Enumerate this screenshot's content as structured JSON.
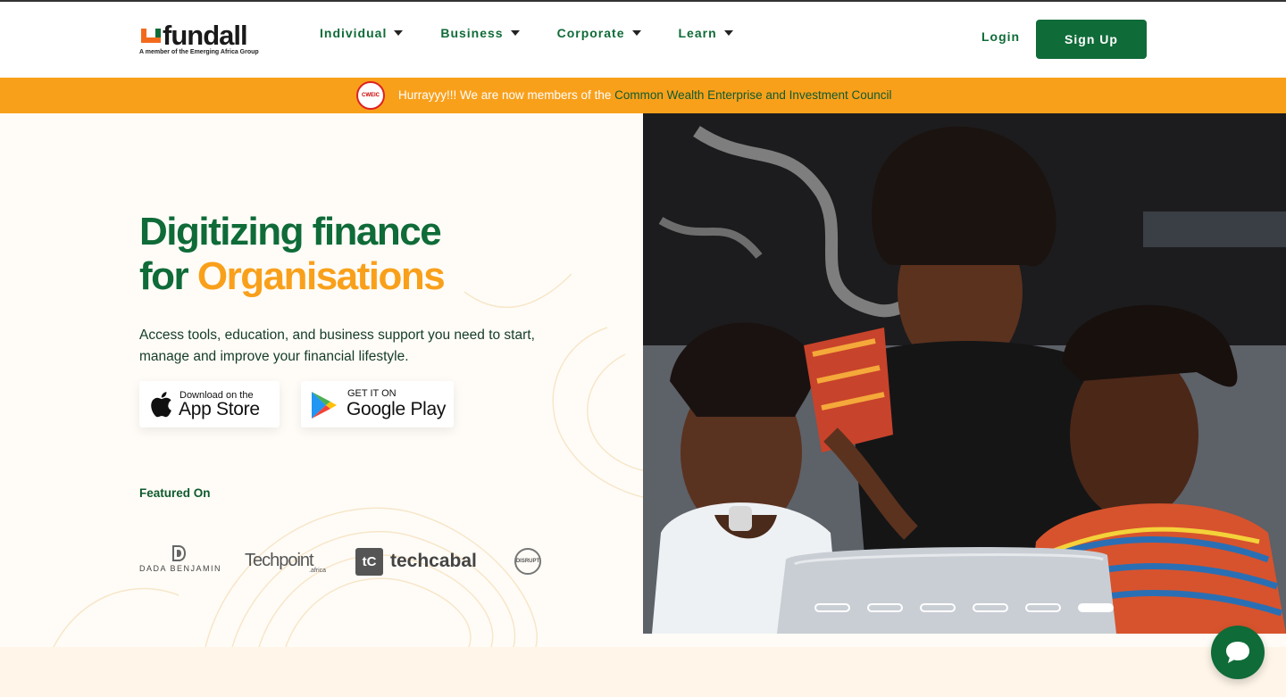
{
  "brand": {
    "name": "fundall",
    "tagline": "A member of the Emerging Africa Group"
  },
  "nav": {
    "items": [
      {
        "label": "Individual"
      },
      {
        "label": "Business"
      },
      {
        "label": "Corporate"
      },
      {
        "label": "Learn"
      }
    ],
    "login_label": "Login",
    "signup_label": "Sign Up"
  },
  "banner": {
    "badge_text": "CWEIC",
    "text": "Hurrayyy!!! We are now members of the ",
    "link_text": "Common Wealth Enterprise and Investment Council"
  },
  "hero": {
    "title_line1": "Digitizing finance",
    "title_for": "for ",
    "title_accent": "Organisations",
    "description": "Access tools, education, and business support you need to start, manage and improve your financial lifestyle.",
    "app_store": {
      "small": "Download on the",
      "big": "App Store"
    },
    "google_play": {
      "small": "GET IT ON",
      "big": "Google Play"
    },
    "featured_label": "Featured On",
    "press": {
      "dada": "DADA BENJAMIN",
      "techpoint": "Techpoint",
      "techpoint_sub": ".africa",
      "techcabal_icon": "tC",
      "techcabal": "techcabal",
      "disrupt": "DISRUPT"
    }
  },
  "carousel": {
    "slide_count": 6,
    "active_index": 5
  },
  "colors": {
    "brand_green": "#0f6b38",
    "accent_orange": "#f9a01b",
    "hero_bg": "#fffcf7"
  },
  "icons": {
    "caret": "caret-down-icon",
    "apple": "apple-icon",
    "play": "google-play-icon",
    "chat": "chat-bubble-icon"
  }
}
